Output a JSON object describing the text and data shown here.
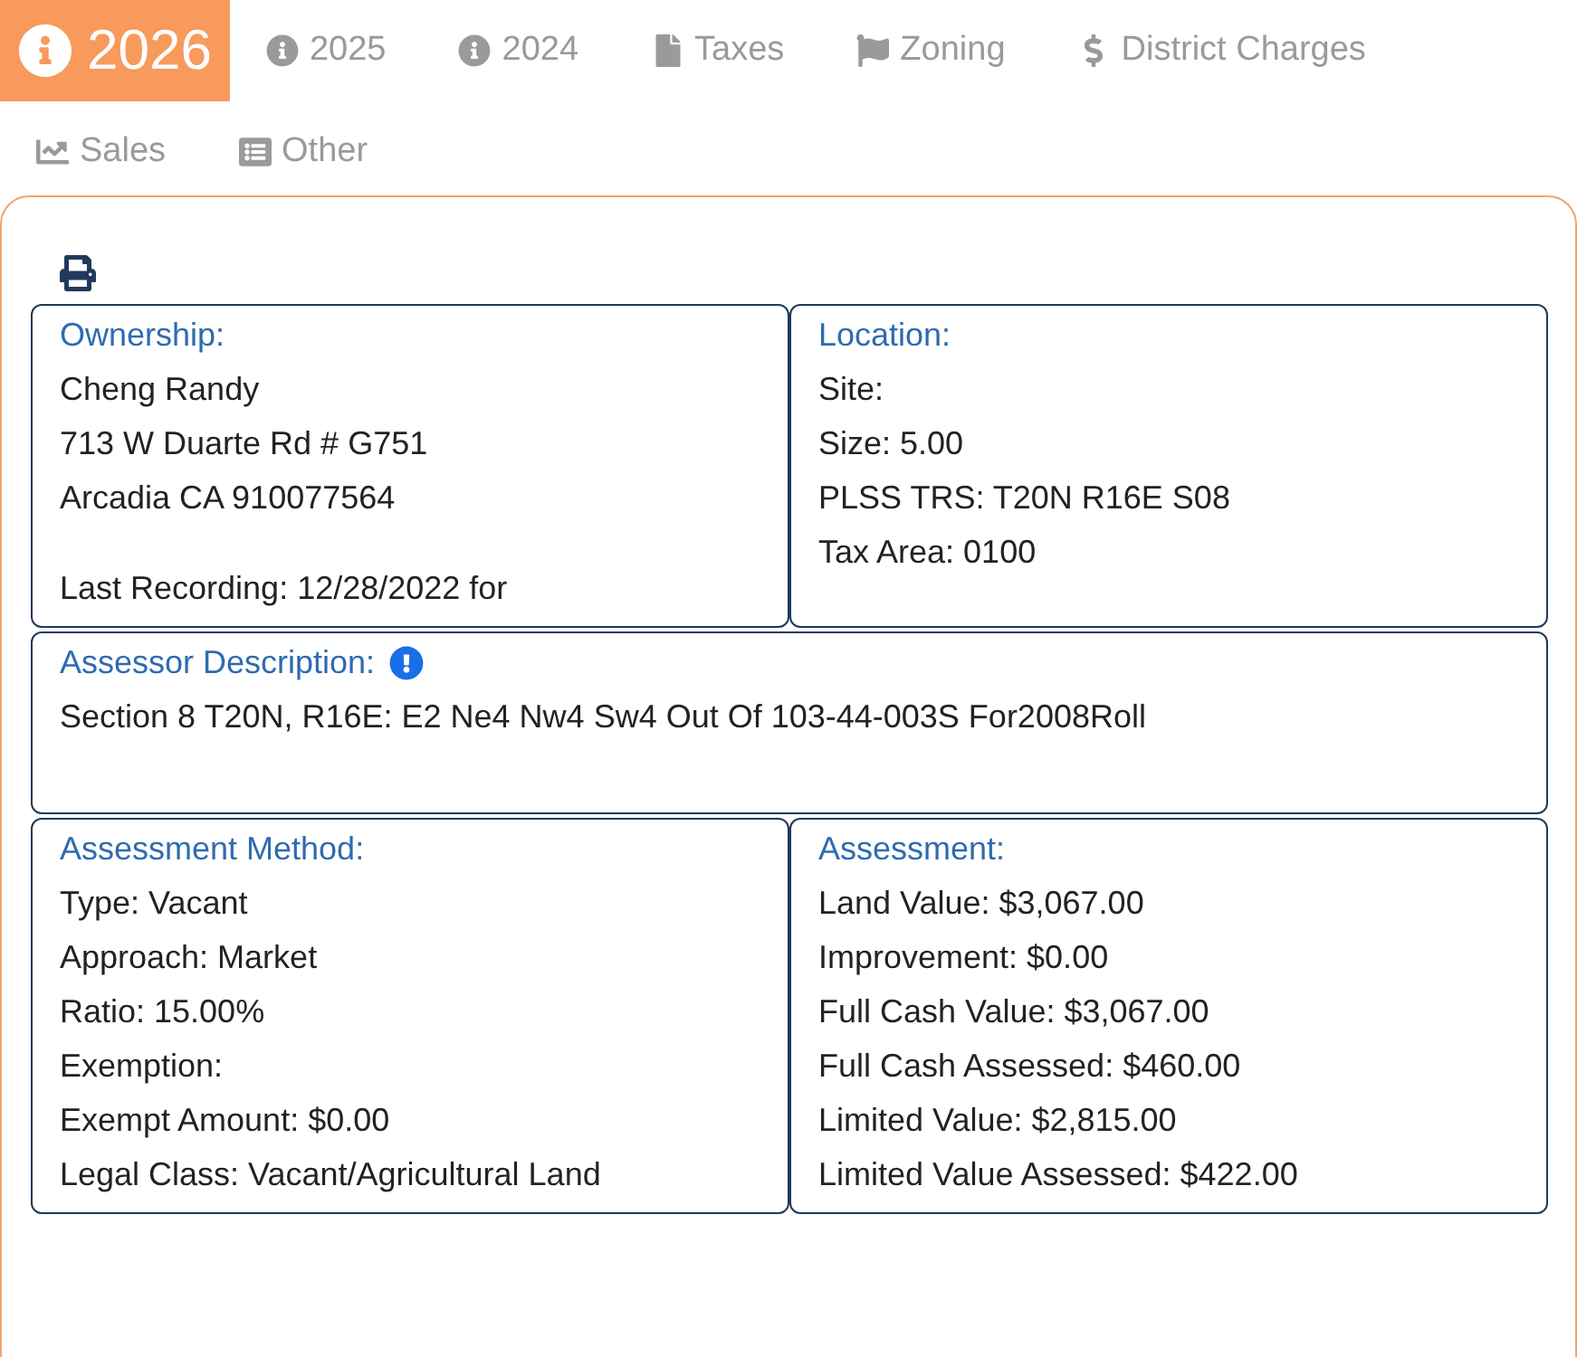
{
  "tabs": [
    {
      "label": "2026",
      "kind": "info",
      "selected": true
    },
    {
      "label": "2025",
      "kind": "info",
      "selected": false
    },
    {
      "label": "2024",
      "kind": "info",
      "selected": false
    },
    {
      "label": "Taxes",
      "kind": "file",
      "selected": false
    },
    {
      "label": "Zoning",
      "kind": "flag",
      "selected": false
    },
    {
      "label": "District Charges",
      "kind": "dollar",
      "selected": false
    },
    {
      "label": "Sales",
      "kind": "chart",
      "selected": false
    },
    {
      "label": "Other",
      "kind": "list",
      "selected": false
    }
  ],
  "ownership": {
    "title": "Ownership:",
    "lines": [
      "Cheng Randy",
      "713 W Duarte Rd # G751",
      "Arcadia CA 910077564"
    ],
    "last_recording": "Last Recording: 12/28/2022 for"
  },
  "location": {
    "title": "Location:",
    "lines": [
      "Site:",
      "Size: 5.00",
      "PLSS TRS: T20N R16E S08",
      "Tax Area: 0100"
    ]
  },
  "assessor_description": {
    "title": "Assessor Description:",
    "text": "Section 8 T20N, R16E: E2 Ne4 Nw4 Sw4 Out Of 103-44-003S For2008Roll"
  },
  "assessment_method": {
    "title": "Assessment Method:",
    "lines": [
      "Type: Vacant",
      "Approach: Market",
      "Ratio: 15.00%",
      "Exemption:",
      "Exempt Amount: $0.00",
      "Legal Class: Vacant/Agricultural Land"
    ]
  },
  "assessment": {
    "title": "Assessment:",
    "lines": [
      "Land Value: $3,067.00",
      "Improvement: $0.00",
      "Full Cash Value: $3,067.00",
      "Full Cash Assessed: $460.00",
      "Limited Value: $2,815.00",
      "Limited Value Assessed: $422.00"
    ]
  }
}
